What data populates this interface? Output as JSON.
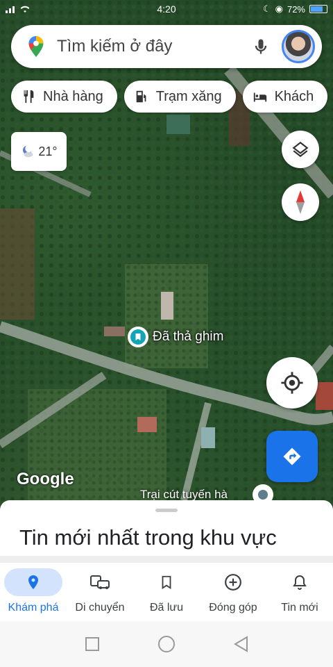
{
  "status_bar": {
    "time": "4:20",
    "battery": "72%"
  },
  "search": {
    "placeholder": "Tìm kiếm ở đây"
  },
  "chips": [
    {
      "label": "Nhà hàng",
      "icon": "restaurant-icon"
    },
    {
      "label": "Trạm xăng",
      "icon": "gas-station-icon"
    },
    {
      "label": "Khách",
      "icon": "hotel-icon"
    }
  ],
  "weather": {
    "temperature": "21°"
  },
  "map": {
    "dropped_pin_label": "Đã thả ghim",
    "place_label": "Trại cút tuyến hà",
    "attribution": "Google"
  },
  "sheet": {
    "title": "Tin mới nhất trong khu vực"
  },
  "bottom_nav": [
    {
      "label": "Khám phá",
      "icon": "explore-pin-icon",
      "active": true
    },
    {
      "label": "Di chuyển",
      "icon": "commute-icon",
      "active": false
    },
    {
      "label": "Đã lưu",
      "icon": "bookmark-icon",
      "active": false
    },
    {
      "label": "Đóng góp",
      "icon": "add-circle-icon",
      "active": false
    },
    {
      "label": "Tin mới",
      "icon": "bell-icon",
      "active": false
    }
  ],
  "colors": {
    "accent": "#1a73e8",
    "pin": "#12a5b5",
    "active_nav_bg": "#d3e3fd"
  }
}
